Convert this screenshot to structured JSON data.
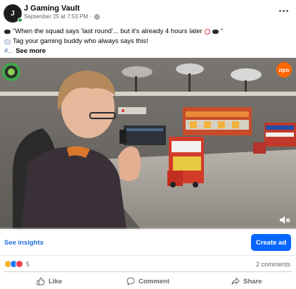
{
  "post": {
    "page_name": "J Gaming Vault",
    "avatar_initial": "J",
    "timestamp": "September 25 at 7:53 PM",
    "dot": "·",
    "caption_line1": "\"When the squad says 'last round'... but it's already 4 hours later",
    "caption_line2": "Tag your gaming buddy who always says this!",
    "hashtag": "#...",
    "see_more": "See more"
  },
  "video": {
    "overlay_badge": "npo",
    "progress_fraction": 0.0
  },
  "insights": {
    "see_insights": "See insights",
    "create_ad": "Create ad"
  },
  "engagement": {
    "reaction_count": "5",
    "comments": "2 comments"
  },
  "actions": {
    "like": "Like",
    "comment": "Comment",
    "share": "Share"
  },
  "colors": {
    "primary_blue": "#0866ff",
    "link_blue": "#216fdb",
    "muted_text": "#65676b",
    "online_green": "#31a24c",
    "npo_orange": "#ff6600"
  },
  "icons": {
    "globe": "globe-icon",
    "more": "more-horizontal-icon",
    "controller": "video-game-icon",
    "alarm": "alarm-clock-icon",
    "speech": "speech-bubble-icon",
    "volume": "volume-muted-icon",
    "like": "thumbs-up-icon",
    "comment": "comment-icon",
    "share": "share-arrow-icon"
  }
}
